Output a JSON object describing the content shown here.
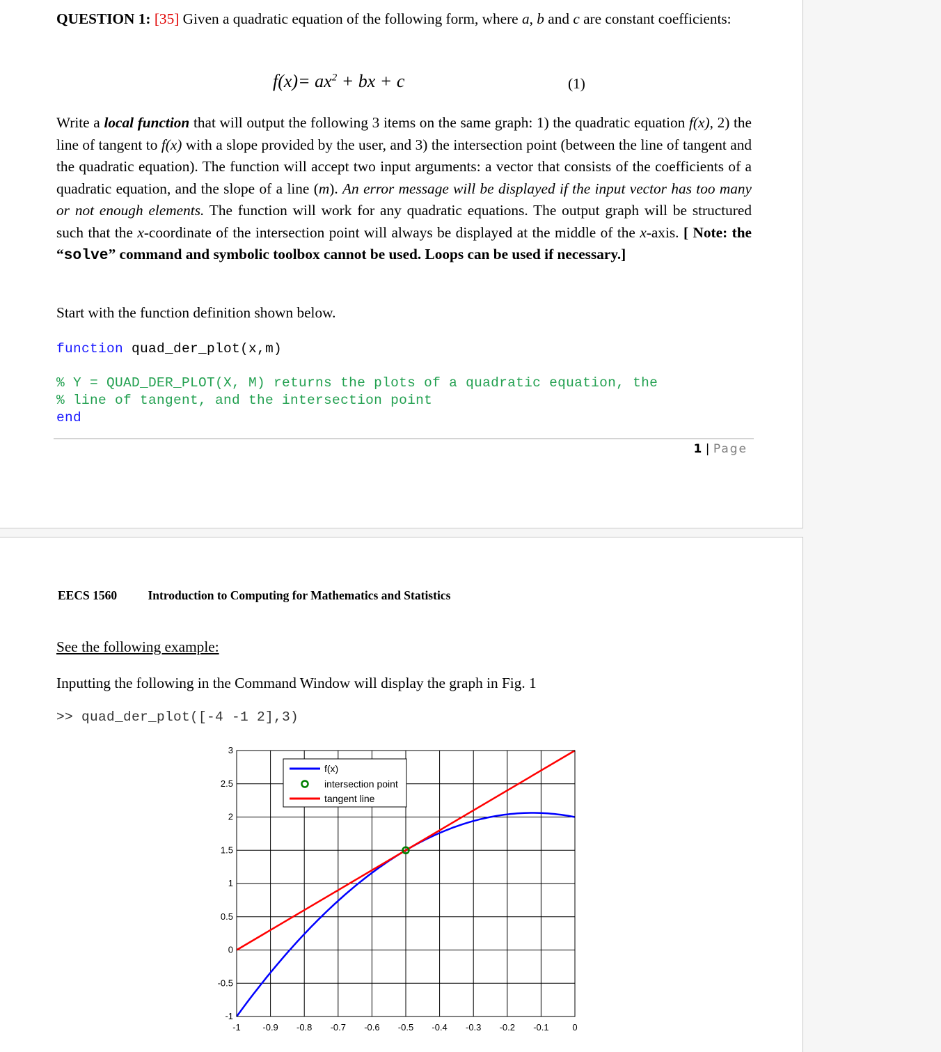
{
  "page1": {
    "question": {
      "label": "QUESTION 1:",
      "points": "[35]",
      "intro_a": " Given a quadratic equation of the following form, where ",
      "var_a": "a",
      "sep1": ", ",
      "var_b": "b",
      "and": " and ",
      "var_c": "c",
      "intro_b": " are constant coefficients:"
    },
    "equation": {
      "text": "f(x) = ax² + bx + c",
      "lhs": "f(x)",
      "rhs_a": "= ax",
      "rhs_exp": "2",
      "rhs_b": " + bx + c",
      "number": "(1)"
    },
    "body": {
      "s1": "Write a ",
      "s2_em": "local function",
      "s3": " that will output the following 3 items on the same graph: 1) the quadratic equation ",
      "fx1": "f(x)",
      "s4": ", 2) the line of tangent to ",
      "fx2": "f(x)",
      "s5": " with a slope provided by the user, and 3) the intersection point (between the line of tangent and the quadratic equation).  The function will accept two input arguments: a vector that consists of the coefficients of a quadratic equation, and the slope of a line (",
      "m": "m",
      "s6": ").  ",
      "s7_em": "An error message will be displayed if the input vector has too many or not enough elements.",
      "s8": "  The function will work for any quadratic equations.   The output graph will be structured such that the ",
      "x1": "x",
      "s9": "-coordinate of the intersection point will always be displayed at the middle of the ",
      "x2": "x",
      "s10": "-axis. ",
      "note_a": "[ Note: the “",
      "note_code": "solve",
      "note_b": "” command and symbolic toolbox cannot be used.  Loops can be used if necessary.]"
    },
    "start_text": "Start with the function definition shown below.",
    "code": {
      "line1_kw": "function",
      "line1_rest": " quad_der_plot(x,m)",
      "comment1": "% Y = QUAD_DER_PLOT(X, M) returns the plots of a quadratic equation, the",
      "comment2": "% line of tangent, and the intersection point",
      "end_kw": "end"
    },
    "footer": {
      "page_number": "1",
      "separator": " | ",
      "page_word": "Page"
    }
  },
  "page2": {
    "header": {
      "course_code": "EECS 1560",
      "course_title": "Introduction to Computing for Mathematics and Statistics"
    },
    "see_example": "See the following example:",
    "inputting_text": "Inputting the following in the Command Window will display the graph in Fig. 1",
    "command": ">> quad_der_plot([-4 -1 2],3)"
  },
  "colors": {
    "points_red": "#e00000",
    "keyword_blue": "#1a1aff",
    "comment_green": "#22a050",
    "fx_line": "#0000ff",
    "tangent_line": "#ff0000",
    "intersection_marker": "#008000"
  },
  "chart_data": {
    "type": "line",
    "title": "",
    "xlabel": "",
    "ylabel": "",
    "xlim": [
      -1,
      0
    ],
    "ylim": [
      -1,
      3
    ],
    "grid": true,
    "x_ticks": [
      "-1",
      "-0.9",
      "-0.8",
      "-0.7",
      "-0.6",
      "-0.5",
      "-0.4",
      "-0.3",
      "-0.2",
      "-0.1",
      "0"
    ],
    "y_ticks": [
      "-1",
      "-0.5",
      "0",
      "0.5",
      "1",
      "1.5",
      "2",
      "2.5",
      "3"
    ],
    "legend_position": "top-center",
    "legend": [
      "f(x)",
      "intersection point",
      "tangent line"
    ],
    "coefficients": [
      -4,
      -1,
      2
    ],
    "slope": 3,
    "series": [
      {
        "name": "f(x)",
        "color": "#0000ff",
        "x": [
          -1.0,
          -0.9,
          -0.8,
          -0.7,
          -0.6,
          -0.5,
          -0.4,
          -0.3,
          -0.2,
          -0.1,
          0.0
        ],
        "y": [
          -1.0,
          -0.34,
          0.24,
          0.74,
          1.16,
          1.5,
          1.76,
          1.94,
          2.04,
          2.06,
          2.0
        ]
      },
      {
        "name": "tangent line",
        "color": "#ff0000",
        "x": [
          -1.0,
          0.0
        ],
        "y": [
          0.0,
          3.0
        ]
      },
      {
        "name": "intersection point",
        "color": "#008000",
        "marker": "o",
        "x": [
          -0.5
        ],
        "y": [
          1.5
        ]
      }
    ]
  }
}
